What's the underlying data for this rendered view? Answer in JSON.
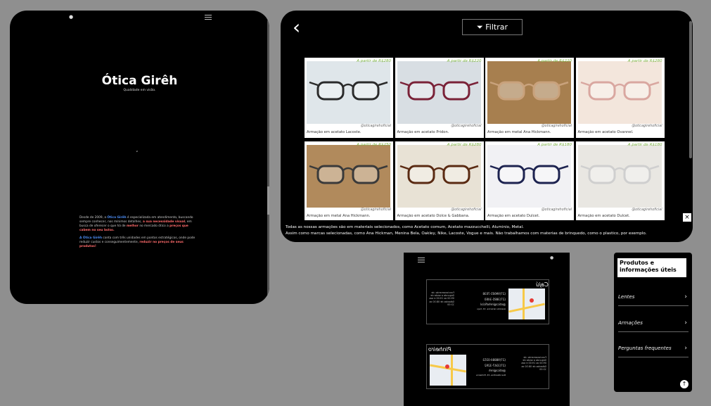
{
  "hero": {
    "brand": "Ótica Girêh",
    "tagline": "Qualidade em visão.",
    "about": {
      "p1_a": "Desde de 2009, a ",
      "p1_brand": "Ótica Girêh",
      "p1_b": " é especializada em atendimento, buscando sempre conhecer, nos mínimos detalhes, ",
      "p1_red1": "a sua necessidade visual",
      "p1_c": ", em busca de oferecer o que há de ",
      "p1_red2": "melhor",
      "p1_d": " no mercado ótico a ",
      "p1_red3": "preços que cabem no seu bolso.",
      "p2_brand": "A Ótica Girêh",
      "p2_a": " conta com três unidades em pontos estratégicos, onde pode reduzir custos e conseguimentemente, ",
      "p2_red": "reduzir no preços de seus produtos!"
    }
  },
  "catalog": {
    "back_icon": "‹",
    "filter_label": "Filtrar",
    "products": [
      {
        "price": "A partir de R$280",
        "handle": "@oticagirehoficial",
        "name": "Armação em acetato Lacoste.",
        "frame": "#2b2b2b",
        "bg": "#dfe6ea"
      },
      {
        "price": "A partir de R$220",
        "handle": "@oticagirehoficial",
        "name": "Armação em acetato Pridon.",
        "frame": "#7a2238",
        "bg": "#d8dee3"
      },
      {
        "price": "A partir de R$220",
        "handle": "@oticagirehoficial",
        "name": "Armação em metal Ana Hickmann.",
        "frame": "#c9a27c",
        "bg": "#a77f4f"
      },
      {
        "price": "A partir de R$280",
        "handle": "@oticagirehoficial",
        "name": "Armação em acetato Ovannel.",
        "frame": "#d9a7a0",
        "bg": "#f3e6dc"
      },
      {
        "price": "A partir de R$250",
        "handle": "@oticagirehoficial",
        "name": "Armação em metal Ana Hickmann.",
        "frame": "#3a3a3a",
        "bg": "#b18a5c"
      },
      {
        "price": "A partir de R$280",
        "handle": "@oticagirehoficial",
        "name": "Armação em acetato Dolce & Gabbana.",
        "frame": "#5a2a12",
        "bg": "#e8e2d5"
      },
      {
        "price": "A partir de R$180",
        "handle": "@oticagirehoficial",
        "name": "Armação em acetato Dulcet.",
        "frame": "#1d2350",
        "bg": "#f1f1f4"
      },
      {
        "price": "A partir de R$180",
        "handle": "@oticagirehoficial",
        "name": "Armação em acetato Dulcet.",
        "frame": "#cfcfcf",
        "bg": "#e9e7e2"
      }
    ],
    "footnote_line1": "Todas as nossas armações são em materiais selecionados, como Acetato comum, Acetato mazzucchelli, Aluminio, Metal.",
    "footnote_line2": "Assim como marcas selecionadas, como Ana Hickman, Menina Bela, Oakley, Nike, Lacoste, Vogue e mais. Não trabalhamos com materias de brinquedo, como o plastico, por exemplo.",
    "close_icon": "×"
  },
  "locations": [
    {
      "title": "Cajú",
      "phone1": "(27)99665-7038",
      "phone2": "(27)3885-3460",
      "instagram": "@oticagirehoficial",
      "address": "Avenida cariacica, 13, Caju",
      "hours": "Funcionamento: de Segunda a sexta de 09:00 as 19:00 e aos Sábados de 08:30 as 12:00"
    },
    {
      "title": "Pinheiro",
      "phone1": "(27)98884-0353",
      "phone2": "(27)3347-3292",
      "instagram": "@oticagireh",
      "address": "Rua Valentina, 15, Pinheiros",
      "hours": "Funcionamento: de Segunda a sexta de 09:00 as 19:00 e aos Sábados de 08:30 as 12:00"
    }
  ],
  "menu": {
    "heading": "Produtos e informações úteis",
    "items": [
      "Lentes",
      "Armações",
      "Perguntas frequentes"
    ],
    "arrow": "›",
    "up_icon": "↑"
  }
}
